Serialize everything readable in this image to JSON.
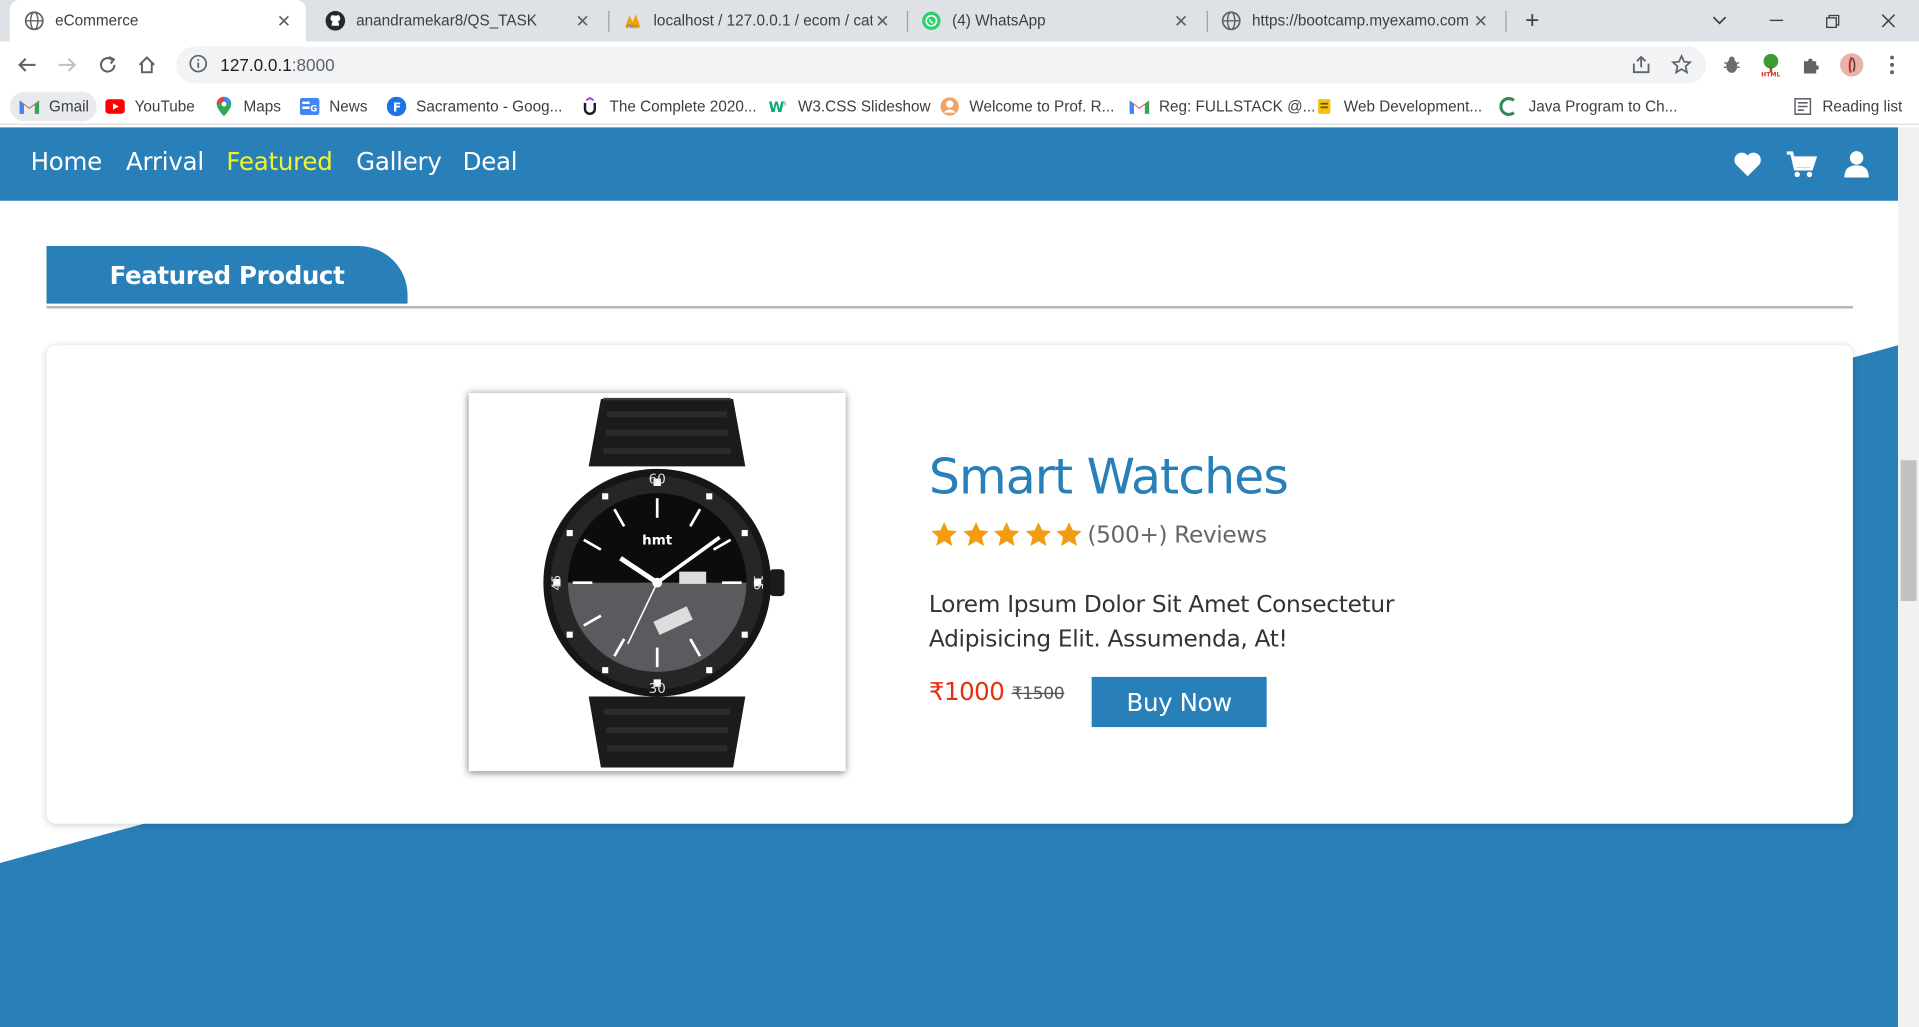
{
  "browser": {
    "tabs": [
      {
        "title": "eCommerce",
        "icon": "globe-icon",
        "active": true
      },
      {
        "title": "anandramekar8/QS_TASK",
        "icon": "github-icon"
      },
      {
        "title": "localhost / 127.0.0.1 / ecom / cat",
        "icon": "phpmyadmin-icon"
      },
      {
        "title": "(4) WhatsApp",
        "icon": "whatsapp-icon"
      },
      {
        "title": "https://bootcamp.myexamo.com",
        "icon": "globe-icon"
      }
    ],
    "url_host": "127.0.0.1",
    "url_port": ":8000",
    "bookmarks": [
      {
        "label": "Gmail",
        "icon": "gmail-icon"
      },
      {
        "label": "YouTube",
        "icon": "youtube-icon"
      },
      {
        "label": "Maps",
        "icon": "maps-icon"
      },
      {
        "label": "News",
        "icon": "news-icon"
      },
      {
        "label": "Sacramento - Goog...",
        "icon": "font-icon"
      },
      {
        "label": "The Complete 2020...",
        "icon": "udemy-icon"
      },
      {
        "label": "W3.CSS Slideshow",
        "icon": "w3schools-icon"
      },
      {
        "label": "Welcome to Prof. R...",
        "icon": "profile-icon"
      },
      {
        "label": "Reg: FULLSTACK @...",
        "icon": "gmail-icon"
      },
      {
        "label": "Web Development...",
        "icon": "bookmark-icon"
      },
      {
        "label": "Java Program to Ch...",
        "icon": "bookmark-icon"
      }
    ],
    "reading_list": "Reading list"
  },
  "nav": {
    "links": [
      "Home",
      "Arrival",
      "Featured",
      "Gallery",
      "Deal"
    ],
    "active": "Featured",
    "icons": [
      "heart-icon",
      "cart-icon",
      "user-icon"
    ]
  },
  "section": {
    "heading": "Featured Product"
  },
  "product": {
    "image_alt": "hmt black wrist watch",
    "title": "Smart Watches",
    "rating_stars": 5,
    "reviews": "(500+) Reviews",
    "description": "Lorem Ipsum Dolor Sit Amet Consectetur Adipisicing Elit. Assumenda, At!",
    "price": "₹1000",
    "old_price": "₹1500",
    "buy_label": "Buy Now"
  },
  "colors": {
    "primary": "#2980b9",
    "nav_active": "#f1f527",
    "price": "#e8300c",
    "star": "#f39c12"
  }
}
